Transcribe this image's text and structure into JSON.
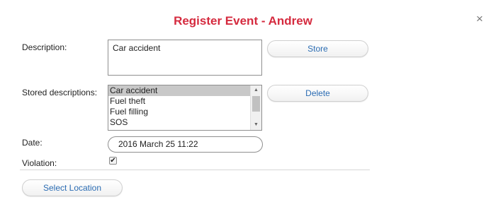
{
  "dialog": {
    "title": "Register Event - Andrew",
    "close_glyph": "×"
  },
  "form": {
    "description_label": "Description:",
    "description_value": "Car accident",
    "store_button": "Store",
    "stored_descriptions_label": "Stored descriptions:",
    "stored_descriptions": [
      "Car accident",
      "Fuel theft",
      "Fuel filling",
      "SOS"
    ],
    "selected_stored_description": "Car accident",
    "delete_button": "Delete",
    "date_label": "Date:",
    "date_value": "2016 March 25 11:22",
    "violation_label": "Violation:",
    "violation_checked": true,
    "select_location_button": "Select Location"
  },
  "colors": {
    "title": "#d52b3f",
    "button_text": "#2b6cb3",
    "selected_item_bg": "#c8c8c8"
  },
  "icons": {
    "close": "close-icon",
    "checkbox_mark": "checkmark-icon",
    "scroll_up": "scroll-up-arrow-icon",
    "scroll_down": "scroll-down-arrow-icon"
  }
}
